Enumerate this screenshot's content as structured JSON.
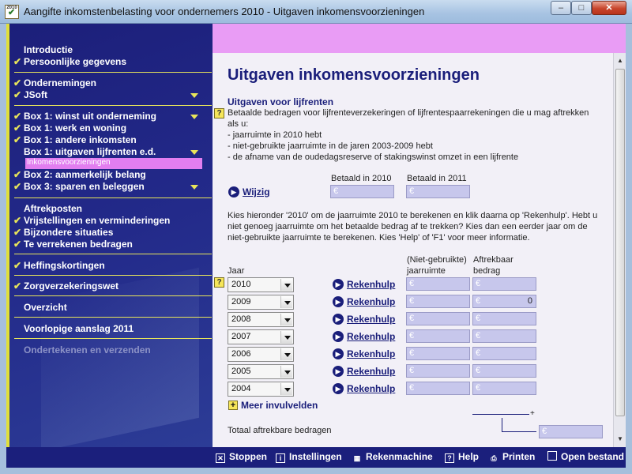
{
  "window": {
    "icon_text": "2010",
    "title": "Aangifte inkomstenbelasting voor ondernemers 2010 - Uitgaven inkomensvoorzieningen",
    "min_label": "–",
    "max_label": "□",
    "close_label": "✕"
  },
  "sidebar": {
    "items": [
      {
        "label": "Introductie",
        "checked": false
      },
      {
        "label": "Persoonlijke gegevens",
        "checked": true
      },
      {
        "label": "Ondernemingen",
        "checked": true
      },
      {
        "label": "JSoft",
        "checked": true,
        "expand": true
      },
      {
        "label": "Box 1: winst uit onderneming",
        "checked": true,
        "expand": true
      },
      {
        "label": "Box 1: werk en woning",
        "checked": true
      },
      {
        "label": "Box 1: andere inkomsten",
        "checked": true
      },
      {
        "label": "Box 1: uitgaven lijfrenten e.d.",
        "checked": false,
        "expand": true
      },
      {
        "label": "Inkomensvoorzieningen",
        "selected": true
      },
      {
        "label": "Box 2: aanmerkelijk belang",
        "checked": true
      },
      {
        "label": "Box 3: sparen en beleggen",
        "checked": true,
        "expand": true
      },
      {
        "label": "Aftrekposten",
        "checked": false
      },
      {
        "label": "Vrijstellingen en verminderingen",
        "checked": true
      },
      {
        "label": "Bijzondere situaties",
        "checked": true
      },
      {
        "label": "Te verrekenen bedragen",
        "checked": true
      },
      {
        "label": "Heffingskortingen",
        "checked": true
      },
      {
        "label": "Zorgverzekeringswet",
        "checked": true
      },
      {
        "label": "Overzicht",
        "checked": false
      },
      {
        "label": "Voorlopige aanslag 2011",
        "checked": false
      },
      {
        "label": "Ondertekenen en verzenden",
        "disabled": true
      }
    ]
  },
  "main": {
    "title": "Uitgaven inkomensvoorzieningen",
    "section_title": "Uitgaven voor lijfrenten",
    "intro_lines": [
      "Betaalde bedragen voor lijfrenteverzekeringen of lijfrentespaarrekeningen die u mag aftrekken",
      "als u:",
      "- jaarruimte in 2010 hebt",
      "- niet-gebruikte jaarruimte in de jaren 2003-2009 hebt",
      "- de afname van de oudedagsreserve of stakingswinst omzet in een lijfrente"
    ],
    "paid_2010_label": "Betaald in 2010",
    "paid_2011_label": "Betaald in 2011",
    "wijzig_label": "Wijzig",
    "currency": "€",
    "explain_lines": [
      "Kies hieronder '2010' om de jaarruimte 2010 te berekenen en klik daarna op 'Rekenhulp'. Hebt u",
      "niet genoeg jaarruimte om het betaalde bedrag af te trekken? Kies dan een eerder jaar om de",
      "niet-gebruikte jaarruimte te berekenen. Kies 'Help' of 'F1' voor meer informatie."
    ],
    "col_jaar": "Jaar",
    "col_ruimte_1": "(Niet-gebruikte)",
    "col_ruimte_2": "jaarruimte",
    "col_aftrek_1": "Aftrekbaar",
    "col_aftrek_2": "bedrag",
    "rekenhulp_label": "Rekenhulp",
    "rows": [
      {
        "year": "2010",
        "ruimte": "",
        "aftrek": ""
      },
      {
        "year": "2009",
        "ruimte": "",
        "aftrek": "0"
      },
      {
        "year": "2008",
        "ruimte": "",
        "aftrek": ""
      },
      {
        "year": "2007",
        "ruimte": "",
        "aftrek": ""
      },
      {
        "year": "2006",
        "ruimte": "",
        "aftrek": ""
      },
      {
        "year": "2005",
        "ruimte": "",
        "aftrek": ""
      },
      {
        "year": "2004",
        "ruimte": "",
        "aftrek": ""
      }
    ],
    "more_fields_label": "Meer invulvelden",
    "plus_sign": "+",
    "total_label": "Totaal aftrekbare bedragen",
    "help_mark": "?"
  },
  "toolbar": {
    "stoppen": "Stoppen",
    "instellingen": "Instellingen",
    "rekenmachine": "Rekenmachine",
    "help": "Help",
    "printen": "Printen",
    "open_bestand": "Open bestand"
  }
}
